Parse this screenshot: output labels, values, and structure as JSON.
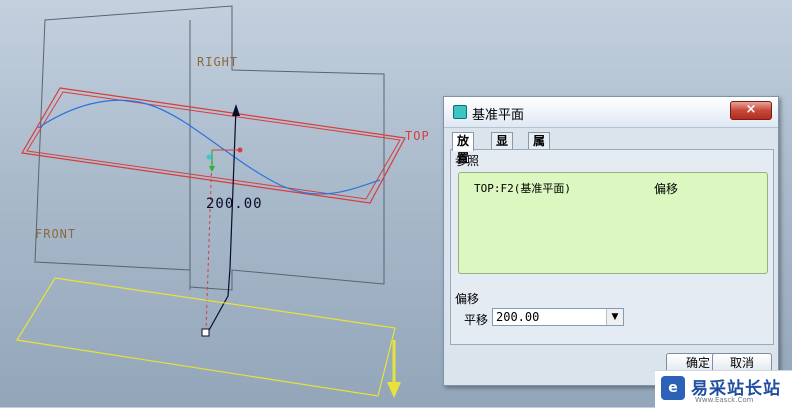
{
  "viewport": {
    "planes": {
      "right": "RIGHT",
      "top": "TOP",
      "front": "FRONT"
    },
    "dimension": "200.00"
  },
  "dialog": {
    "title": "基准平面",
    "close_label": "×",
    "tabs": [
      {
        "label": "放置"
      },
      {
        "label": "显示"
      },
      {
        "label": "属性"
      }
    ],
    "references_label": "参照",
    "reference": {
      "name": "TOP:F2(基准平面)",
      "type": "偏移"
    },
    "offset_label": "偏移",
    "translate_label": "平移",
    "translate_value": "200.00",
    "ok_label": "确定",
    "cancel_label": "取消"
  },
  "watermark": {
    "title": "易采站长站",
    "url": "Www.Easck.Com"
  },
  "colors": {
    "plane_gray": "#5a6470",
    "plane_red": "#d83c3c",
    "curve": "#2a74e0",
    "preview_plane": "#e8e23a",
    "reference_box": "#dcf8c0"
  }
}
